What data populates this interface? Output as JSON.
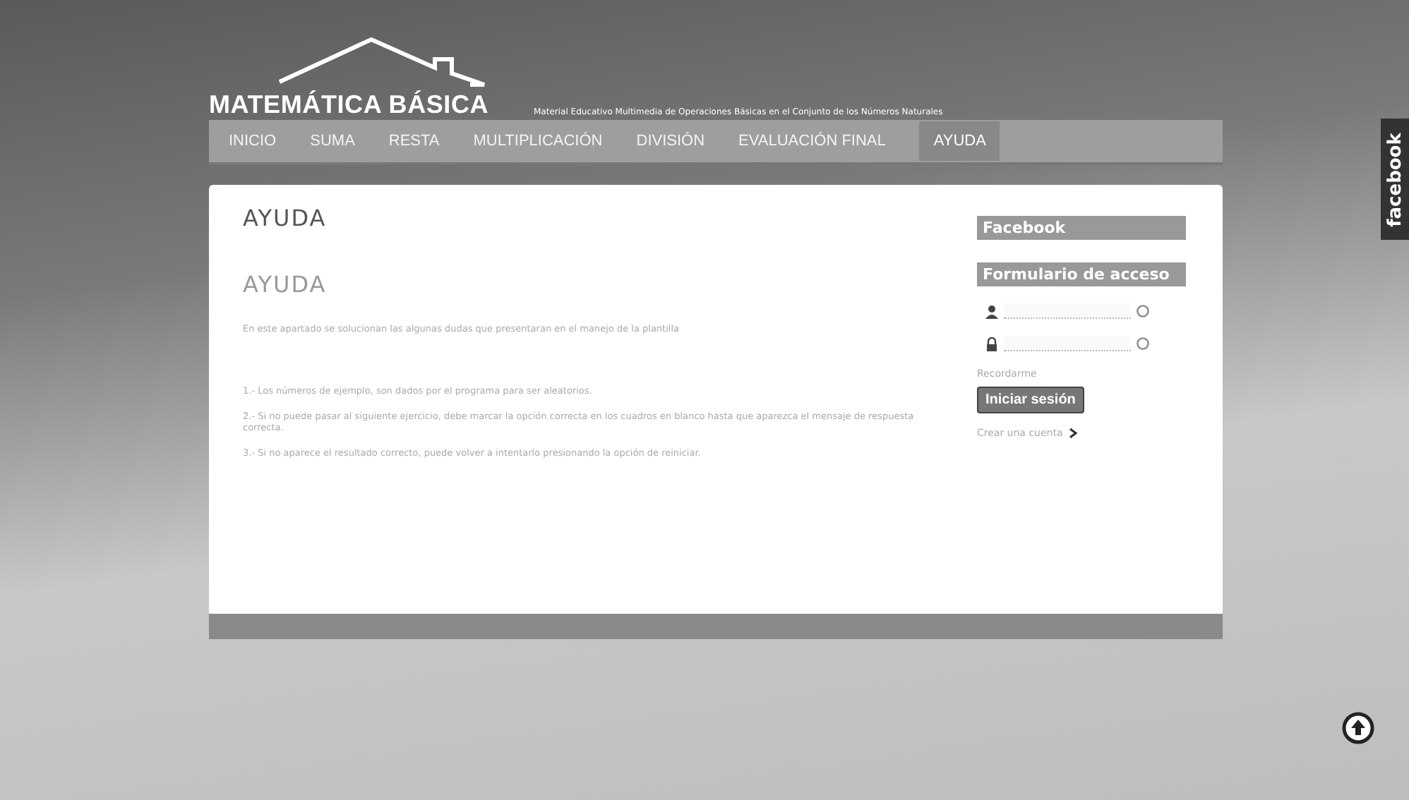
{
  "site": {
    "logo": "MATEMÁTICA BÁSICA",
    "tagline": "Material Educativo Multimedia de Operaciones Básicas en el Conjunto de los Números Naturales"
  },
  "nav": [
    {
      "label": "INICIO",
      "selected": false
    },
    {
      "label": "SUMA",
      "selected": false
    },
    {
      "label": "RESTA",
      "selected": false
    },
    {
      "label": "MULTIPLICACIÓN",
      "selected": false
    },
    {
      "label": "DIVISIÓN",
      "selected": false
    },
    {
      "label": "EVALUACIÓN FINAL",
      "selected": false
    },
    {
      "label": "AYUDA",
      "selected": true
    }
  ],
  "article": {
    "page_title": "AYUDA",
    "heading": "AYUDA",
    "intro": "En este apartado se solucionan las algunas dudas que presentaran en el manejo de la plantilla",
    "items": [
      "1.- Los números de ejemplo, son dados por el programa para ser aleatorios.",
      "2.- Si no puede pasar al siguiente ejercicio, debe marcar la opción correcta en los cuadros en blanco hasta que aparezca el mensaje de respuesta correcta.",
      "3.- Si no aparece el resultado correcto, puede volver a intentarlo presionando la opción de reiniciar."
    ]
  },
  "sidebar": {
    "facebook_title": "Facebook",
    "login_title": "Formulario de acceso",
    "remember": "Recordarme",
    "login_button": "Iniciar sesión",
    "create_account": "Crear una cuenta"
  },
  "facebook_tab": "facebook"
}
